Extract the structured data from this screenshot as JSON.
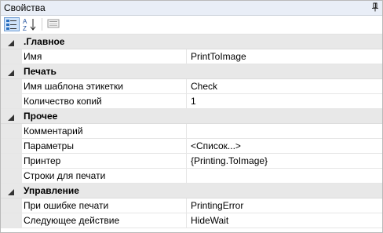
{
  "panel": {
    "title": "Свойства",
    "pin_icon": "pin-icon"
  },
  "toolbar": {
    "buttons": [
      {
        "icon": "categorized-view-icon",
        "active": true
      },
      {
        "icon": "alphabetical-sort-icon",
        "label_top": "A",
        "label_bottom": "Z",
        "active": false
      },
      {
        "icon": "property-pages-icon",
        "active": false
      }
    ]
  },
  "categories": [
    {
      "label": ".Главное",
      "rows": [
        {
          "name": "Имя",
          "value": "PrintToImage"
        }
      ]
    },
    {
      "label": "Печать",
      "rows": [
        {
          "name": "Имя шаблона этикетки",
          "value": "Check"
        },
        {
          "name": "Количество копий",
          "value": "1"
        }
      ]
    },
    {
      "label": "Прочее",
      "rows": [
        {
          "name": "Комментарий",
          "value": ""
        },
        {
          "name": "Параметры",
          "value": "<Список...>"
        },
        {
          "name": "Принтер",
          "value": "{Printing.ToImage}"
        },
        {
          "name": "Строки для печати",
          "value": ""
        }
      ]
    },
    {
      "label": "Управление",
      "rows": [
        {
          "name": "При ошибке печати",
          "value": "PrintingError"
        },
        {
          "name": "Следующее действие",
          "value": "HideWait"
        }
      ]
    }
  ],
  "colors": {
    "titlebar": "#e9eef7",
    "gutter": "#e8e8e8",
    "active_button": "#cfe3fa"
  }
}
